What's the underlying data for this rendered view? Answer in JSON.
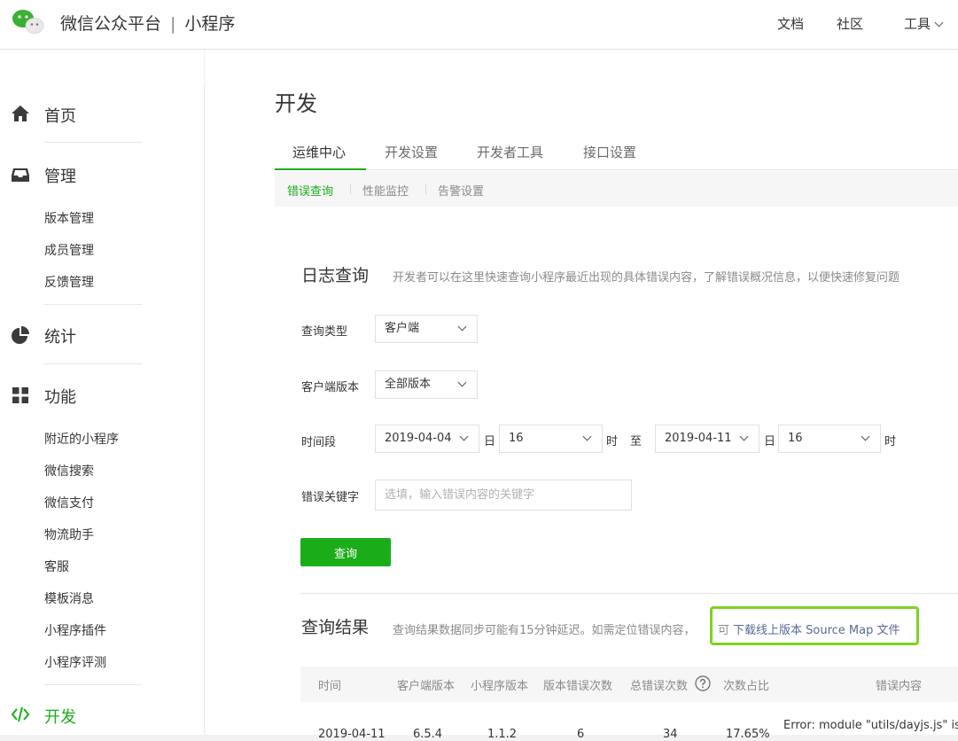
{
  "header": {
    "brand": "微信公众平台",
    "product": "小程序",
    "separator": "|",
    "nav": {
      "docs": "文档",
      "community": "社区",
      "tools": "工具"
    }
  },
  "sidebar": {
    "home": "首页",
    "manage": {
      "title": "管理",
      "items": [
        "版本管理",
        "成员管理",
        "反馈管理"
      ]
    },
    "stats": "统计",
    "features": {
      "title": "功能",
      "items": [
        "附近的小程序",
        "微信搜索",
        "微信支付",
        "物流助手",
        "客服",
        "模板消息",
        "小程序插件",
        "小程序评测"
      ]
    },
    "develop": "开发"
  },
  "page": {
    "title": "开发",
    "tabs": [
      "运维中心",
      "开发设置",
      "开发者工具",
      "接口设置"
    ],
    "subtabs": [
      "错误查询",
      "性能监控",
      "告警设置"
    ]
  },
  "log_query": {
    "title": "日志查询",
    "desc": "开发者可以在这里快速查询小程序最近出现的具体错误内容，了解错误概况信息，以便快速修复问题",
    "query_type_label": "查询类型",
    "query_type_value": "客户端",
    "client_version_label": "客户端版本",
    "client_version_value": "全部版本",
    "time_label": "时间段",
    "start_date": "2019-04-04",
    "day_unit": "日",
    "start_hour": "16",
    "hour_unit": "时",
    "to_label": "至",
    "end_date": "2019-04-11",
    "end_hour": "16",
    "keyword_label": "错误关键字",
    "keyword_placeholder": "选填，输入错误内容的关键字",
    "submit": "查询"
  },
  "results": {
    "title": "查询结果",
    "desc": "查询结果数据同步可能有15分钟延迟。如需定位错误内容，",
    "link_prefix": "可",
    "link": "下载线上版本 Source Map 文件",
    "columns": [
      "时间",
      "客户端版本",
      "小程序版本",
      "版本错误次数",
      "总错误次数",
      "次数占比",
      "错误内容"
    ],
    "rows": [
      [
        "2019-04-11",
        "6.5.4",
        "1.1.2",
        "6",
        "34",
        "17.65%",
        "Error: module \"utils/dayjs.js\" is n"
      ]
    ]
  },
  "colors": {
    "brand_green": "#1aad19",
    "link_blue": "#576b95",
    "highlight": "#7ed321"
  }
}
